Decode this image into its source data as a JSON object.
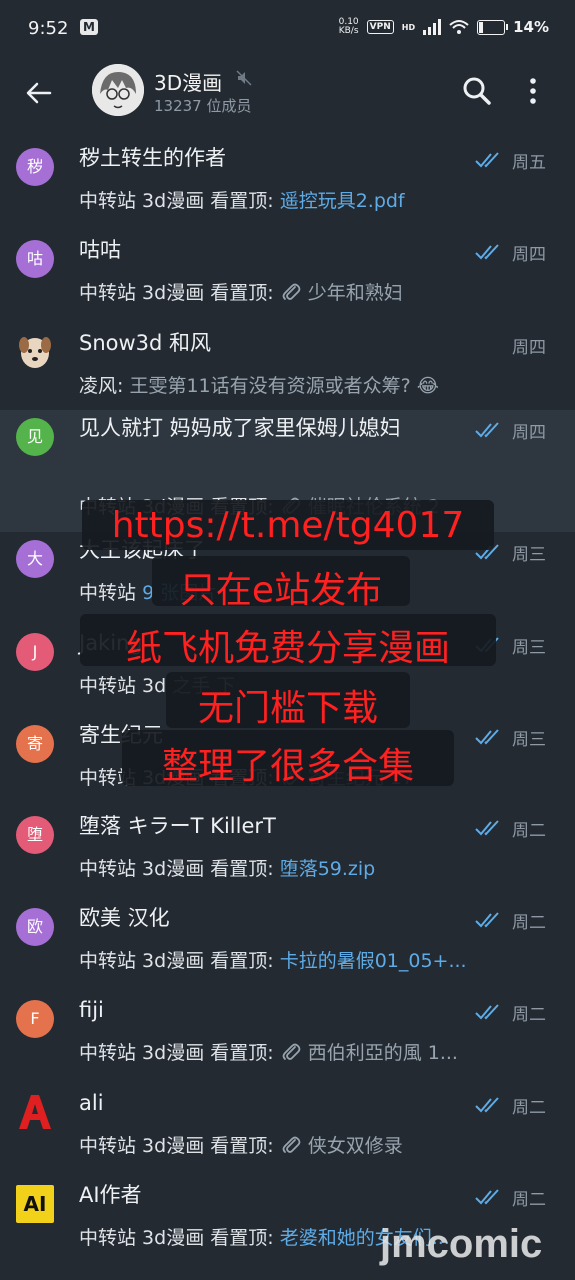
{
  "status": {
    "time": "9:52",
    "net_speed_top": "0.10",
    "net_speed_bottom": "KB/s",
    "vpn": "VPN",
    "hd": "HD",
    "battery": "14%",
    "battery_level": 0.14
  },
  "header": {
    "title": "3D漫画",
    "members": "13237 位成员"
  },
  "chats": [
    {
      "avatar_text": "秽",
      "avatar_color": "#a66fd6",
      "name": "秽土转生的作者",
      "sender": "中转站 3d漫画 看置顶:",
      "message": "遥控玩具2.pdf",
      "message_style": "blue",
      "clip": false,
      "ticks": true,
      "day": "周五"
    },
    {
      "avatar_text": "咕",
      "avatar_color": "#a66fd6",
      "name": "咕咕",
      "sender": "中转站 3d漫画 看置顶:",
      "message": "少年和熟妇",
      "message_style": "grey",
      "clip": true,
      "ticks": true,
      "day": "周四"
    },
    {
      "avatar_text": "",
      "avatar_color": "#caa07a",
      "name": "Snow3d 和风",
      "sender": "凌风:",
      "message": "王雯第11话有没有资源或者众筹? 😂",
      "message_style": "grey",
      "clip": false,
      "ticks": false,
      "day": "周四"
    },
    {
      "avatar_text": "见",
      "avatar_color": "#54b34a",
      "name": "见人就打 妈妈成了家里保姆儿媳妇",
      "sender": "中转站 3d漫画 看置顶:",
      "message": "催眠社伦系统 2",
      "message_style": "grey",
      "clip": true,
      "ticks": true,
      "day": "周四"
    },
    {
      "avatar_text": "大",
      "avatar_color": "#a66fd6",
      "name": "大王该起床了",
      "sender": "中转站",
      "message": "9 张图片",
      "message_style": "blue",
      "clip": false,
      "ticks": true,
      "day": "周三"
    },
    {
      "avatar_text": "J",
      "avatar_color": "#e45b77",
      "name": "Jaking",
      "sender": "中转站 3d",
      "message": "之手 下",
      "message_style": "grey",
      "clip": false,
      "ticks": true,
      "day": "周三"
    },
    {
      "avatar_text": "寄",
      "avatar_color": "#e4724d",
      "name": "寄生纪元",
      "sender": "中转站 3d漫画 看置顶:",
      "message": "寄生纪元 17",
      "message_style": "grey",
      "clip": true,
      "ticks": true,
      "day": "周三"
    },
    {
      "avatar_text": "堕",
      "avatar_color": "#e45b77",
      "name": "堕落 キラーT KillerT",
      "sender": "中转站 3d漫画 看置顶:",
      "message": "堕落59.zip",
      "message_style": "blue",
      "clip": false,
      "ticks": true,
      "day": "周二"
    },
    {
      "avatar_text": "欧",
      "avatar_color": "#a66fd6",
      "name": "欧美 汉化",
      "sender": "中转站 3d漫画 看置顶:",
      "message": "卡拉的暑假01_05+...",
      "message_style": "blue",
      "clip": false,
      "ticks": true,
      "day": "周二"
    },
    {
      "avatar_text": "F",
      "avatar_color": "#e4724d",
      "name": "fiji",
      "sender": "中转站 3d漫画 看置顶:",
      "message": "西伯利亞的風 1...",
      "message_style": "grey",
      "clip": true,
      "ticks": true,
      "day": "周二"
    },
    {
      "avatar_text": "A",
      "avatar_color": "#e02020",
      "name": "ali",
      "sender": "中转站 3d漫画 看置顶:",
      "message": "侠女双修录",
      "message_style": "grey",
      "clip": true,
      "ticks": true,
      "day": "周二"
    },
    {
      "avatar_text": "AI",
      "avatar_color": "#f2d11a",
      "name": "AI作者",
      "sender": "中转站 3d漫画 看置顶:",
      "message": "老婆和她的女友们...",
      "message_style": "blue",
      "clip": false,
      "ticks": true,
      "day": "周二"
    }
  ],
  "overlay": {
    "lines": [
      "https://t.me/tg4017",
      "只在e站发布",
      "纸飞机免费分享漫画",
      "无门槛下载",
      "整理了很多合集"
    ],
    "color": "#ff2020"
  },
  "watermark": "jmcomic"
}
